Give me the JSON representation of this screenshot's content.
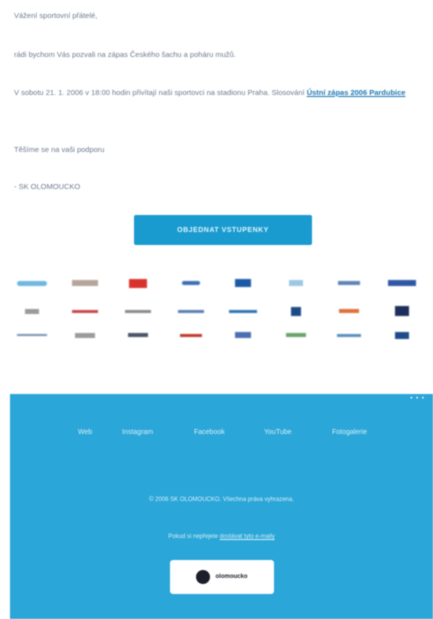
{
  "email": {
    "greeting": "Vážení sportovní přátelé,",
    "para1": "rádi bychom Vás pozvali na zápas Českého šachu a poháru mužů.",
    "para2_text": "V sobotu 21. 1. 2006 v 18:00 hodin přivítají naši sportovci na stadionu Praha. Slosování ",
    "para2_link": "Ústní zápas 2006 Pardubice",
    "para3": "Těšíme se na vaši podporu",
    "signature": "- SK OLOMOUCKO"
  },
  "cta": {
    "label": "OBJEDNAT VSTUPENKY"
  },
  "colors": {
    "accent": "#1a9bd0",
    "footer_bg": "#2aa6d8",
    "link": "#1f78b4",
    "body_text": "#6e7b8f"
  },
  "sponsors": {
    "row1": [
      "sponsor-logo",
      "sponsor-logo",
      "sponsor-logo",
      "sponsor-logo",
      "sponsor-logo",
      "sponsor-logo",
      "sponsor-logo",
      "sponsor-logo"
    ],
    "row2": [
      "sponsor-logo",
      "sponsor-logo",
      "sponsor-logo",
      "sponsor-logo",
      "sponsor-logo",
      "sponsor-logo",
      "sponsor-logo",
      "sponsor-logo"
    ],
    "row3": [
      "sponsor-logo",
      "sponsor-logo",
      "sponsor-logo",
      "sponsor-logo",
      "sponsor-logo",
      "sponsor-logo",
      "sponsor-logo",
      "sponsor-logo"
    ]
  },
  "footer": {
    "nav": [
      "Web",
      "Instagram",
      "Facebook",
      "YouTube",
      "Fotogalerie"
    ],
    "copyright": "© 2006 SK OLOMOUCKO. Všechna práva vyhrazena.",
    "unsubscribe_prefix": "Pokud si nepřejete ",
    "unsubscribe_link": "dostávat tyto e-maily",
    "logo_text": "olomoucko"
  }
}
